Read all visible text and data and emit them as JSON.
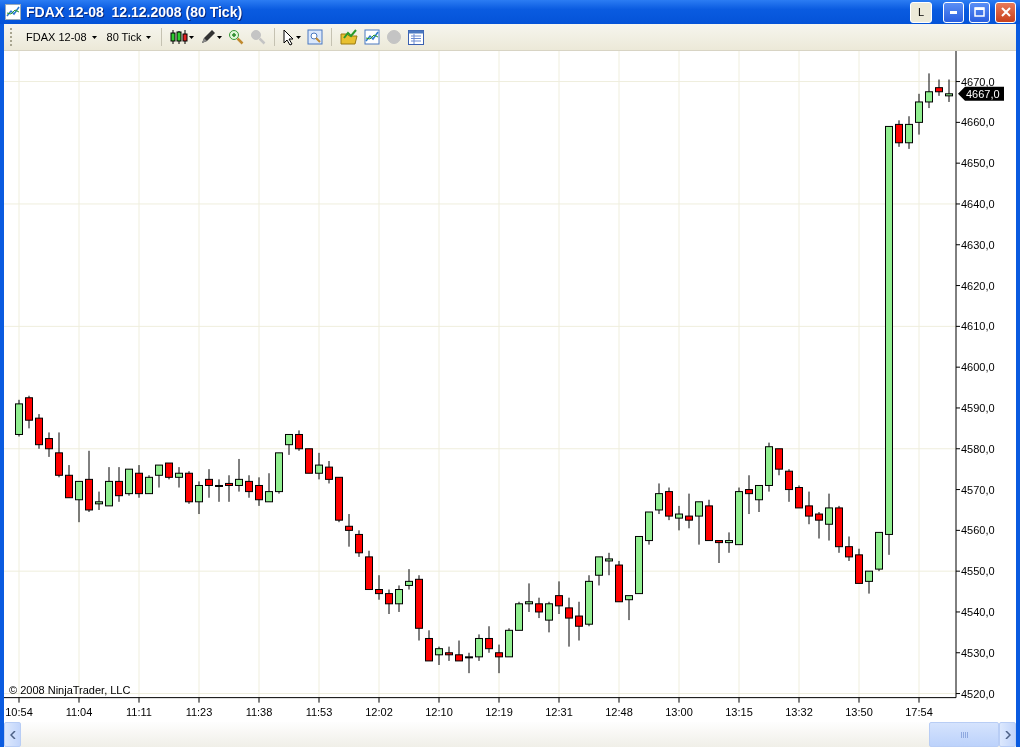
{
  "window": {
    "title": "FDAX 12-08  12.12.2008 (80 Tick)",
    "link_button": "L"
  },
  "toolbar": {
    "instrument": "FDAX 12-08",
    "interval": "80 Tick",
    "tool_groups": [
      {
        "tools": [
          {
            "kind": "candles",
            "disabled": false,
            "menu": true
          },
          {
            "kind": "pencil",
            "disabled": false,
            "menu": true
          },
          {
            "kind": "zoom-in",
            "disabled": false,
            "menu": false
          },
          {
            "kind": "zoom-out",
            "disabled": true,
            "menu": false
          }
        ]
      },
      {
        "tools": [
          {
            "kind": "cursor",
            "disabled": false,
            "menu": true
          },
          {
            "kind": "zoom-box",
            "disabled": false,
            "menu": false
          }
        ]
      },
      {
        "tools": [
          {
            "kind": "folder",
            "disabled": false,
            "menu": false
          },
          {
            "kind": "line-chart",
            "disabled": false,
            "menu": false
          },
          {
            "kind": "circle",
            "disabled": true,
            "menu": false
          },
          {
            "kind": "table",
            "disabled": false,
            "menu": false
          }
        ]
      }
    ]
  },
  "chart": {
    "copyright": "© 2008 NinjaTrader, LLC",
    "last_price": "4667,0",
    "chart_data": {
      "type": "candlestick",
      "grid": true,
      "ylim": [
        4519,
        4677
      ],
      "yticks": [
        {
          "value": 4520,
          "label": "4520,0"
        },
        {
          "value": 4530,
          "label": "4530,0"
        },
        {
          "value": 4540,
          "label": "4540,0"
        },
        {
          "value": 4550,
          "label": "4550,0"
        },
        {
          "value": 4560,
          "label": "4560,0"
        },
        {
          "value": 4570,
          "label": "4570,0"
        },
        {
          "value": 4580,
          "label": "4580,0"
        },
        {
          "value": 4590,
          "label": "4590,0"
        },
        {
          "value": 4600,
          "label": "4600,0"
        },
        {
          "value": 4610,
          "label": "4610,0"
        },
        {
          "value": 4620,
          "label": "4620,0"
        },
        {
          "value": 4630,
          "label": "4630,0"
        },
        {
          "value": 4640,
          "label": "4640,0"
        },
        {
          "value": 4650,
          "label": "4650,0"
        },
        {
          "value": 4660,
          "label": "4660,0"
        },
        {
          "value": 4670,
          "label": "4670,0"
        }
      ],
      "categories": [
        "10:54",
        null,
        null,
        null,
        null,
        null,
        "11:04",
        null,
        null,
        null,
        null,
        null,
        "11:11",
        null,
        null,
        null,
        null,
        null,
        "11:23",
        null,
        null,
        null,
        null,
        null,
        "11:38",
        null,
        null,
        null,
        null,
        null,
        "11:53",
        null,
        null,
        null,
        null,
        null,
        "12:02",
        null,
        null,
        null,
        null,
        null,
        "12:10",
        null,
        null,
        null,
        null,
        null,
        "12:19",
        null,
        null,
        null,
        null,
        null,
        "12:31",
        null,
        null,
        null,
        null,
        null,
        "12:48",
        null,
        null,
        null,
        null,
        null,
        "13:00",
        null,
        null,
        null,
        null,
        null,
        "13:15",
        null,
        null,
        null,
        null,
        null,
        "13:32",
        null,
        null,
        null,
        null,
        null,
        "13:50",
        null,
        null,
        null,
        null,
        null,
        "17:54",
        null,
        null,
        null
      ],
      "ohlc": [
        [
          4583.5,
          4592,
          4583,
          4591
        ],
        [
          4592.5,
          4593,
          4585,
          4587
        ],
        [
          4587.5,
          4588.5,
          4580,
          4581
        ],
        [
          4582.5,
          4584,
          4578,
          4580
        ],
        [
          4579,
          4584,
          4573,
          4573.5
        ],
        [
          4573.5,
          4576,
          4568,
          4568
        ],
        [
          4567.5,
          4572,
          4562,
          4572
        ],
        [
          4572.5,
          4579.5,
          4564.5,
          4565
        ],
        [
          4566.5,
          4569.5,
          4565,
          4567
        ],
        [
          4566,
          4575.5,
          4566,
          4572
        ],
        [
          4572,
          4575.5,
          4567,
          4568.5
        ],
        [
          4569,
          4575,
          4568.5,
          4575
        ],
        [
          4574,
          4576,
          4568,
          4569
        ],
        [
          4569,
          4573.5,
          4569,
          4573
        ],
        [
          4573.5,
          4576,
          4570.5,
          4576
        ],
        [
          4576.5,
          4576.5,
          4572.5,
          4573
        ],
        [
          4573,
          4575.5,
          4570.5,
          4574
        ],
        [
          4574,
          4574.5,
          4566.5,
          4567
        ],
        [
          4567,
          4572,
          4564,
          4571
        ],
        [
          4572.5,
          4575,
          4568,
          4571
        ],
        [
          4571,
          4572.5,
          4567,
          4571
        ],
        [
          4571.5,
          4573.5,
          4567,
          4571
        ],
        [
          4571,
          4577.5,
          4569.5,
          4572.5
        ],
        [
          4572,
          4573.5,
          4568,
          4569.5
        ],
        [
          4571,
          4573,
          4566,
          4567.5
        ],
        [
          4567,
          4574,
          4567,
          4569.5
        ],
        [
          4569.5,
          4579,
          4569,
          4579
        ],
        [
          4581,
          4583.5,
          4578.5,
          4583.5
        ],
        [
          4583.5,
          4584.5,
          4579.5,
          4580
        ],
        [
          4580,
          4580,
          4574,
          4574
        ],
        [
          4574,
          4579,
          4572.5,
          4576
        ],
        [
          4575.5,
          4577,
          4571.5,
          4572.5
        ],
        [
          4573,
          4573,
          4562,
          4562.5
        ],
        [
          4561,
          4564,
          4556,
          4560
        ],
        [
          4559,
          4560,
          4553.5,
          4554.5
        ],
        [
          4553.5,
          4555,
          4545.5,
          4545.5
        ],
        [
          4545.5,
          4549,
          4543,
          4544.5
        ],
        [
          4544.5,
          4545.5,
          4539.5,
          4542
        ],
        [
          4542,
          4546.5,
          4540,
          4545.5
        ],
        [
          4546.5,
          4550.5,
          4545.5,
          4547.5
        ],
        [
          4548,
          4549,
          4533,
          4536
        ],
        [
          4533.5,
          4535.5,
          4528,
          4528
        ],
        [
          4529.5,
          4531.5,
          4527,
          4531
        ],
        [
          4530,
          4531.5,
          4528,
          4529.5
        ],
        [
          4529.5,
          4533,
          4528,
          4528
        ],
        [
          4529,
          4530,
          4525,
          4529
        ],
        [
          4529,
          4534.5,
          4528,
          4533.5
        ],
        [
          4533.5,
          4536.5,
          4530,
          4531
        ],
        [
          4530,
          4532,
          4525,
          4529
        ],
        [
          4529,
          4536,
          4529,
          4535.5
        ],
        [
          4535.5,
          4542.5,
          4535.5,
          4542
        ],
        [
          4542,
          4547,
          4540,
          4542.5
        ],
        [
          4542,
          4543.5,
          4538.5,
          4540
        ],
        [
          4538,
          4542.5,
          4535,
          4542
        ],
        [
          4544,
          4547.5,
          4539.5,
          4541.5
        ],
        [
          4541,
          4543.5,
          4531.5,
          4538.5
        ],
        [
          4539,
          4542.5,
          4533,
          4536.5
        ],
        [
          4537,
          4549,
          4536.5,
          4547.5
        ],
        [
          4549,
          4553.5,
          4546.5,
          4553.5
        ],
        [
          4552.5,
          4554.5,
          4549,
          4553
        ],
        [
          4551.5,
          4552.5,
          4542.5,
          4542.5
        ],
        [
          4543,
          4544,
          4538,
          4544
        ],
        [
          4544.5,
          4558.5,
          4544.5,
          4558.5
        ],
        [
          4557.5,
          4564.5,
          4556.5,
          4564.5
        ],
        [
          4565,
          4571.5,
          4564,
          4569
        ],
        [
          4569.5,
          4570.5,
          4562.5,
          4563.5
        ],
        [
          4563,
          4566,
          4560,
          4564
        ],
        [
          4563.5,
          4569,
          4560.5,
          4562.5
        ],
        [
          4563.5,
          4567,
          4556.5,
          4567
        ],
        [
          4566,
          4567.5,
          4557.5,
          4557.5
        ],
        [
          4557.5,
          4557.5,
          4552,
          4557
        ],
        [
          4557,
          4559.5,
          4554.5,
          4557.5
        ],
        [
          4556.5,
          4570.5,
          4556.5,
          4569.5
        ],
        [
          4570,
          4573.5,
          4564,
          4569
        ],
        [
          4567.5,
          4571,
          4564.5,
          4571
        ],
        [
          4571,
          4581.5,
          4569.5,
          4580.5
        ],
        [
          4580,
          4580,
          4573.5,
          4575
        ],
        [
          4574.5,
          4575,
          4567,
          4570
        ],
        [
          4570.5,
          4571,
          4565.5,
          4565.5
        ],
        [
          4566,
          4569.5,
          4561.5,
          4563.5
        ],
        [
          4564,
          4564.5,
          4558,
          4562.5
        ],
        [
          4561.5,
          4569,
          4557.5,
          4565.5
        ],
        [
          4565.5,
          4566,
          4554.5,
          4556
        ],
        [
          4556,
          4558.5,
          4552.5,
          4553.5
        ],
        [
          4554,
          4555.5,
          4547,
          4547
        ],
        [
          4547.5,
          4550,
          4544.5,
          4550
        ],
        [
          4550.5,
          4559.5,
          4550,
          4559.5
        ],
        [
          4559,
          4659,
          4554,
          4659
        ],
        [
          4659.5,
          4660.5,
          4654,
          4655
        ],
        [
          4655,
          4661.5,
          4653.5,
          4659.5
        ],
        [
          4660,
          4667,
          4657,
          4665
        ],
        [
          4665,
          4672,
          4663.5,
          4667.5
        ],
        [
          4668.5,
          4670.5,
          4666.5,
          4667.5
        ],
        [
          4666.5,
          4670.5,
          4665,
          4667
        ]
      ]
    }
  }
}
